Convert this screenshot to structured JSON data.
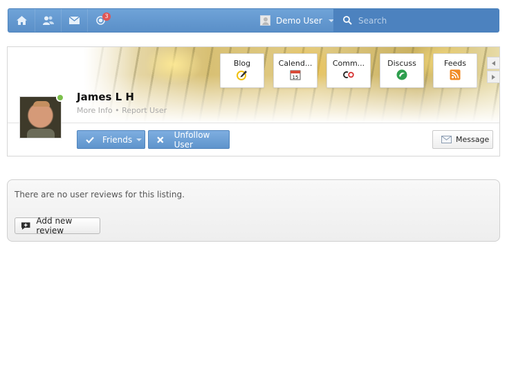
{
  "topbar": {
    "notifications_count": "3",
    "user_name": "Demo User",
    "search_placeholder": "Search"
  },
  "profile": {
    "name": "James L H",
    "more_info": "More Info",
    "separator": "•",
    "report_user": "Report User",
    "tiles": [
      {
        "label": "Blog",
        "icon": "blog-pencil-icon"
      },
      {
        "label": "Calend...",
        "icon": "calendar-icon"
      },
      {
        "label": "Comm...",
        "icon": "community-icon"
      },
      {
        "label": "Discuss",
        "icon": "discuss-icon"
      },
      {
        "label": "Feeds",
        "icon": "rss-feed-icon"
      }
    ],
    "calendar_day": "15",
    "friends_label": "Friends",
    "unfollow_label": "Unfollow User",
    "message_label": "Message"
  },
  "reviews": {
    "empty_message": "There are no user reviews for this listing.",
    "add_label": "Add new review"
  },
  "colors": {
    "topbar": "#5a8fc8",
    "online": "#7cc04b",
    "badge": "#e05555"
  }
}
